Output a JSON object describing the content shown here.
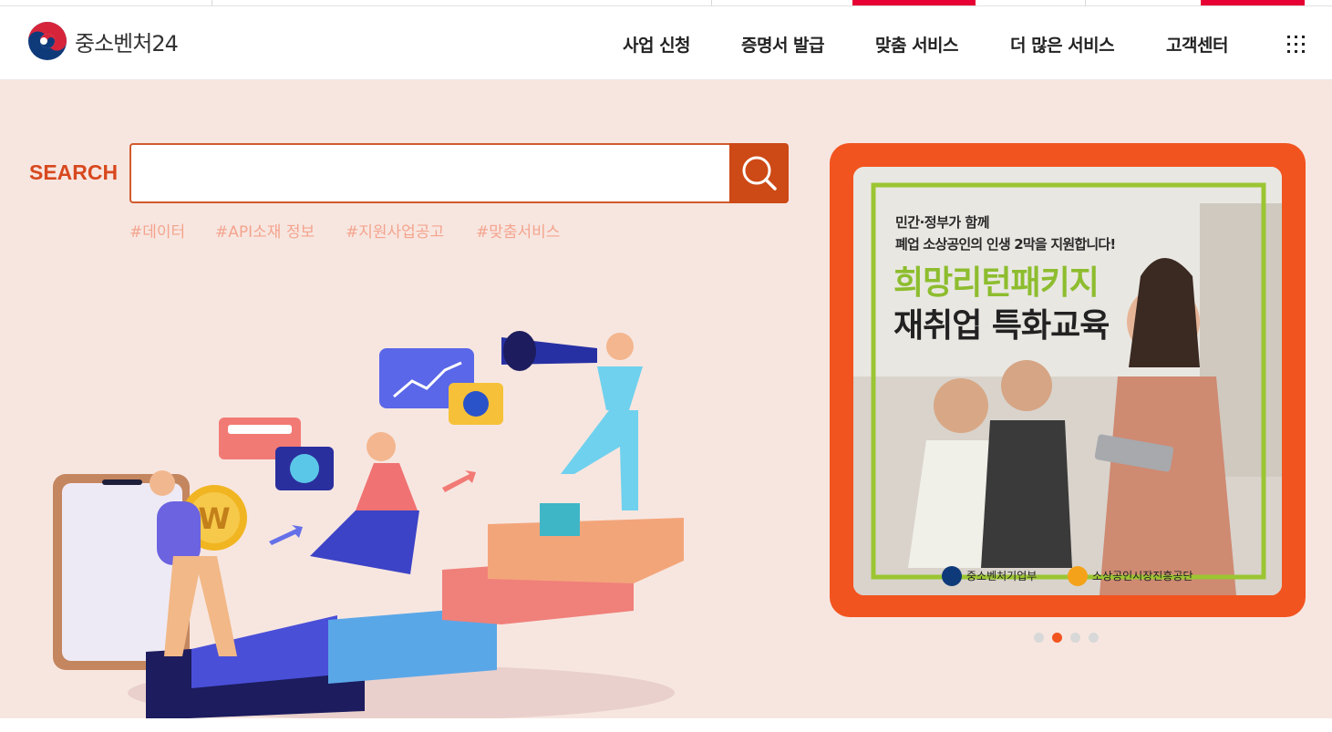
{
  "header": {
    "logo_text": "중소벤처24",
    "nav": [
      {
        "label": "사업 신청"
      },
      {
        "label": "증명서 발급"
      },
      {
        "label": "맞춤 서비스"
      },
      {
        "label": "더 많은 서비스"
      },
      {
        "label": "고객센터"
      }
    ]
  },
  "search": {
    "label": "SEARCH",
    "value": "",
    "placeholder": "",
    "tags": [
      "#데이터",
      "#API소재 정보",
      "#지원사업공고",
      "#맞춤서비스"
    ]
  },
  "banner": {
    "line1": "민간·정부가 함께",
    "line2": "폐업 소상공인의 인생 2막을 지원합니다!",
    "title1": "희망리턴패키지",
    "title2": "재취업 특화교육",
    "org1": "중소벤처기업부",
    "org2": "소상공인시장진흥공단",
    "slide_count": 4,
    "active_slide": 2
  },
  "colors": {
    "accent": "#d8481e",
    "banner_frame": "#f2541f",
    "hero_bg": "#f7e6e0",
    "tag": "#f4a48e",
    "banner_green": "#8dbd2e"
  },
  "icons": [
    "taegeuk-logo-icon",
    "search-icon",
    "grid-menu-icon"
  ]
}
